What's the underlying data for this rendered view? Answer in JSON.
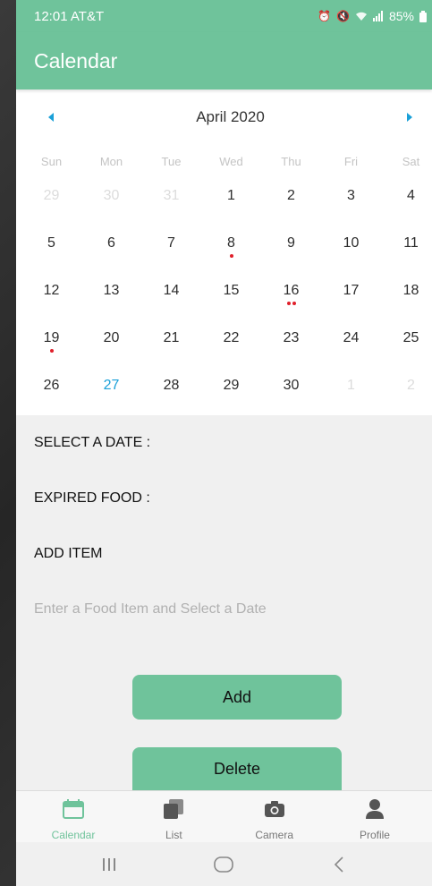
{
  "status_bar": {
    "time": "12:01",
    "carrier": "AT&T",
    "battery": "85%"
  },
  "app_bar": {
    "title": "Calendar"
  },
  "calendar": {
    "month_title": "April 2020",
    "weekdays": [
      "Sun",
      "Mon",
      "Tue",
      "Wed",
      "Thu",
      "Fri",
      "Sat"
    ],
    "days": [
      {
        "label": "29",
        "out": true,
        "dots": 0
      },
      {
        "label": "30",
        "out": true,
        "dots": 0
      },
      {
        "label": "31",
        "out": true,
        "dots": 0
      },
      {
        "label": "1",
        "out": false,
        "dots": 0
      },
      {
        "label": "2",
        "out": false,
        "dots": 0
      },
      {
        "label": "3",
        "out": false,
        "dots": 0
      },
      {
        "label": "4",
        "out": false,
        "dots": 0
      },
      {
        "label": "5",
        "out": false,
        "dots": 0
      },
      {
        "label": "6",
        "out": false,
        "dots": 0
      },
      {
        "label": "7",
        "out": false,
        "dots": 0
      },
      {
        "label": "8",
        "out": false,
        "dots": 1
      },
      {
        "label": "9",
        "out": false,
        "dots": 0
      },
      {
        "label": "10",
        "out": false,
        "dots": 0
      },
      {
        "label": "11",
        "out": false,
        "dots": 0
      },
      {
        "label": "12",
        "out": false,
        "dots": 0
      },
      {
        "label": "13",
        "out": false,
        "dots": 0
      },
      {
        "label": "14",
        "out": false,
        "dots": 0
      },
      {
        "label": "15",
        "out": false,
        "dots": 0
      },
      {
        "label": "16",
        "out": false,
        "dots": 2
      },
      {
        "label": "17",
        "out": false,
        "dots": 0
      },
      {
        "label": "18",
        "out": false,
        "dots": 0
      },
      {
        "label": "19",
        "out": false,
        "dots": 1
      },
      {
        "label": "20",
        "out": false,
        "dots": 0
      },
      {
        "label": "21",
        "out": false,
        "dots": 0
      },
      {
        "label": "22",
        "out": false,
        "dots": 0
      },
      {
        "label": "23",
        "out": false,
        "dots": 0
      },
      {
        "label": "24",
        "out": false,
        "dots": 0
      },
      {
        "label": "25",
        "out": false,
        "dots": 0
      },
      {
        "label": "26",
        "out": false,
        "dots": 0
      },
      {
        "label": "27",
        "out": false,
        "dots": 0,
        "today": true
      },
      {
        "label": "28",
        "out": false,
        "dots": 0
      },
      {
        "label": "29",
        "out": false,
        "dots": 0
      },
      {
        "label": "30",
        "out": false,
        "dots": 0
      },
      {
        "label": "1",
        "out": true,
        "dots": 0
      },
      {
        "label": "2",
        "out": true,
        "dots": 0
      }
    ],
    "accent_color": "#1aa0d8",
    "dot_color": "#e01f2a"
  },
  "form": {
    "select_date_label": "SELECT A DATE :",
    "expired_food_label": "EXPIRED FOOD :",
    "add_item_label": "ADD ITEM",
    "item_input_placeholder": "Enter a Food Item and Select a Date",
    "item_input_value": "",
    "add_button": "Add",
    "delete_button": "Delete"
  },
  "tabbar": {
    "tabs": [
      {
        "label": "Calendar",
        "icon": "calendar-icon",
        "active": true
      },
      {
        "label": "List",
        "icon": "list-icon",
        "active": false
      },
      {
        "label": "Camera",
        "icon": "camera-icon",
        "active": false
      },
      {
        "label": "Profile",
        "icon": "profile-icon",
        "active": false
      }
    ]
  },
  "colors": {
    "brand": "#6fc39b",
    "background": "#f0f0f0"
  }
}
